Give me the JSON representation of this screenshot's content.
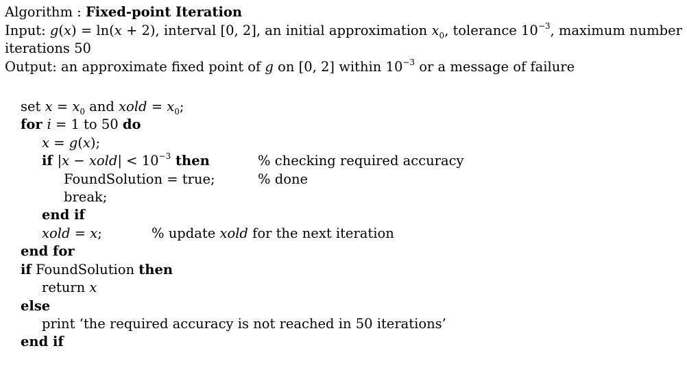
{
  "header": {
    "title_prefix": "Algorithm : ",
    "title_name": "Fixed-point Iteration",
    "input_line1_a": "Input: ",
    "input_g": "g",
    "input_gx": "(",
    "input_x1": "x",
    "input_eq": ") = ln(",
    "input_x2": "x",
    "input_rest1": " + 2), interval [0, 2], an initial approximation ",
    "input_x0": "x",
    "input_x0_sub": "0",
    "input_rest2": ", tolerance 10",
    "input_exp": "−3",
    "input_rest3": ", maximum number of",
    "input_line2": "iterations 50",
    "output_a": "Output: an approximate fixed point of ",
    "output_g": "g",
    "output_b": " on [0, 2] within 10",
    "output_exp": "−3",
    "output_c": " or a message of failure"
  },
  "code": {
    "set_kw": "set ",
    "set_x": "x",
    "set_eq": " = ",
    "set_x0": "x",
    "set_x0_sub": "0",
    "set_and": " and ",
    "set_xold": "xold",
    "set_eq2": " = ",
    "set_x0b": "x",
    "set_x0b_sub": "0",
    "set_semi": ";",
    "for_kw": "for ",
    "for_i": "i",
    "for_range": " = 1 to 50 ",
    "for_do": "do",
    "assign_x": "x",
    "assign_eq": " = ",
    "assign_g": "g",
    "assign_paren1": "(",
    "assign_x2": "x",
    "assign_end": ");",
    "if_kw": "if ",
    "if_abs1": "|",
    "if_x": "x",
    "if_minus": " − ",
    "if_xold": "xold",
    "if_abs2": "| < 10",
    "if_exp": "−3",
    "if_then": " then",
    "comment_accuracy": "% checking required accuracy",
    "found_assign": "FoundSolution = true;",
    "comment_done": "%  done",
    "break_stmt": "break;",
    "end_if_inner": "end if",
    "update_xold": "xold",
    "update_eq": " = ",
    "update_x": "x",
    "update_semi": ";",
    "comment_update_a": "% update ",
    "comment_update_xold": "xold",
    "comment_update_b": " for the next iteration",
    "end_for": "end for",
    "if2_kw": "if",
    "if2_cond": " FoundSolution ",
    "if2_then": "then",
    "return_kw": "return ",
    "return_x": "x",
    "else_kw": "else",
    "print_stmt": "print ‘the required accuracy is not reached in 50 iterations’",
    "end_if_outer": "end if"
  }
}
